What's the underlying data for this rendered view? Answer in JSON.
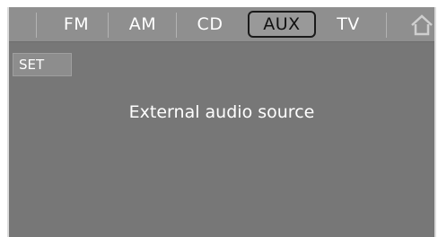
{
  "tabs": [
    {
      "label": "FM"
    },
    {
      "label": "AM"
    },
    {
      "label": "CD"
    },
    {
      "label": "AUX"
    },
    {
      "label": "TV"
    }
  ],
  "active_tab": "AUX",
  "home_icon": "home-icon",
  "set_button": {
    "label": "SET"
  },
  "status": {
    "text": "External audio source"
  }
}
